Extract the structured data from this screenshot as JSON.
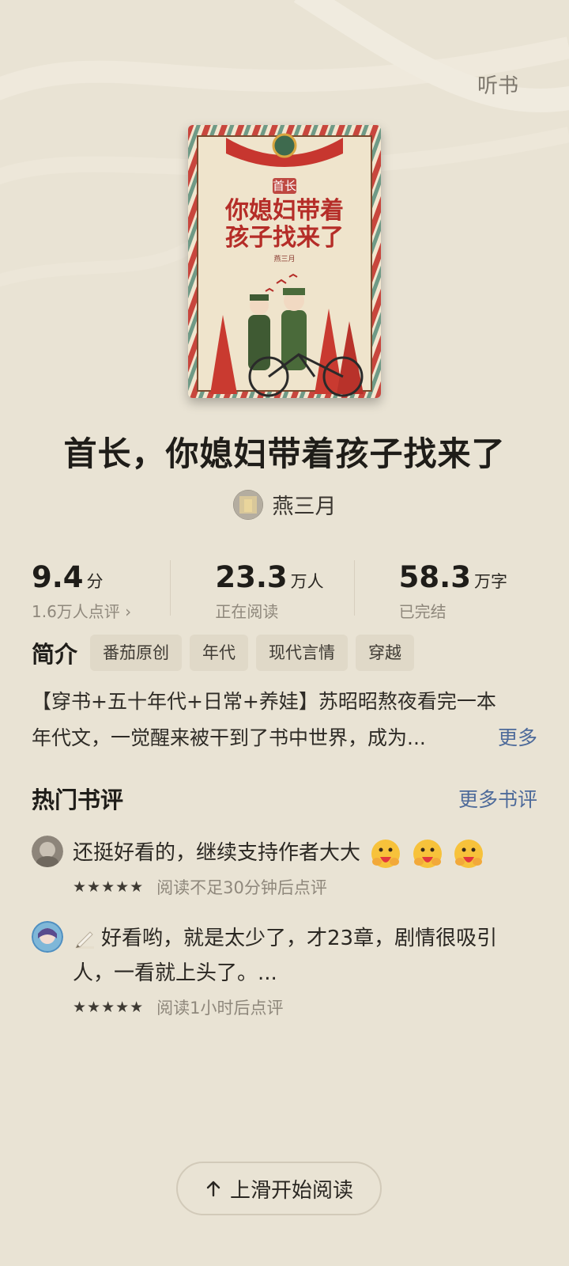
{
  "header": {
    "listen_label": "听书"
  },
  "book": {
    "title": "首长，你媳妇带着孩子找来了",
    "author": "燕三月"
  },
  "cover": {
    "title_small": "首长",
    "title_line1": "你媳妇带着",
    "title_line2": "孩子找来了",
    "author_seal": "燕三月"
  },
  "stats": [
    {
      "number": "9.4",
      "unit": "分",
      "sub": "1.6万人点评 ›"
    },
    {
      "number": "23.3",
      "unit": "万人",
      "sub": "正在阅读"
    },
    {
      "number": "58.3",
      "unit": "万字",
      "sub": "已完结"
    }
  ],
  "intro": {
    "label": "简介",
    "tags": [
      "番茄原创",
      "年代",
      "现代言情",
      "穿越"
    ],
    "desc_line1": "【穿书+五十年代+日常+养娃】苏昭昭熬夜看完一本",
    "desc_line2": "年代文，一觉醒来被干到了书中世界，成为...",
    "more_label": "更多"
  },
  "hot_reviews": {
    "title": "热门书评",
    "more_label": "更多书评",
    "items": [
      {
        "text": "还挺好看的，继续支持作者大大",
        "stars": "★★★★★",
        "note": "阅读不足30分钟后点评"
      },
      {
        "text": "好看哟，就是太少了，才23章，剧情很吸引人，一看就上头了。...",
        "stars": "★★★★★",
        "note": "阅读1小时后点评"
      }
    ]
  },
  "start_button": {
    "label": "上滑开始阅读"
  }
}
